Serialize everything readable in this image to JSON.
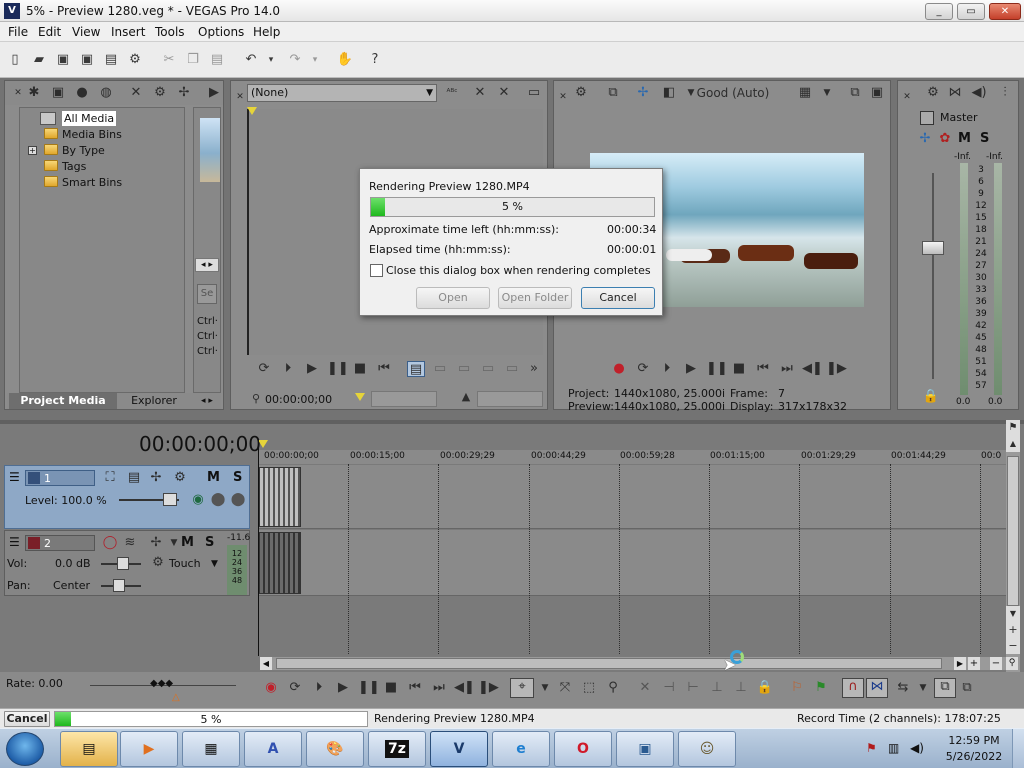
{
  "window": {
    "title": "5% - Preview 1280.veg * - VEGAS Pro 14.0",
    "minimize": "_",
    "maximize": "▭",
    "close": "✕"
  },
  "menu": [
    "File",
    "Edit",
    "View",
    "Insert",
    "Tools",
    "Options",
    "Help"
  ],
  "project_media": {
    "tree": [
      "All Media",
      "Media Bins",
      "By Type",
      "Tags",
      "Smart Bins"
    ],
    "tabs": [
      "Project Media",
      "Explorer"
    ],
    "side_labels": [
      "Ctrl·",
      "Ctrl·",
      "Ctrl·"
    ],
    "arrows": "◂ ▸",
    "se_icon": "Se"
  },
  "trimmer": {
    "dropdown": "(None)",
    "timecode": "00:00:00;00"
  },
  "preview": {
    "quality": "Good (Auto)",
    "project_label": "Project:",
    "project_value": "1440x1080, 25.000i",
    "preview_label": "Preview:",
    "preview_value": "1440x1080, 25.000i",
    "frame_label": "Frame:",
    "frame_value": "7",
    "display_label": "Display:",
    "display_value": "317x178x32"
  },
  "master": {
    "label": "Master",
    "m": "M",
    "s": "S",
    "inf_left": "-Inf.",
    "inf_right": "-Inf.",
    "scale": [
      "3",
      "6",
      "9",
      "12",
      "15",
      "18",
      "21",
      "24",
      "27",
      "30",
      "33",
      "36",
      "39",
      "42",
      "45",
      "48",
      "51",
      "54",
      "57"
    ],
    "bottom_left": "0.0",
    "bottom_right": "0.0"
  },
  "dialog": {
    "title": "Rendering Preview 1280.MP4",
    "progress_label": "5 %",
    "progress": 0.05,
    "time_left_label": "Approximate time left (hh:mm:ss):",
    "time_left_value": "00:00:34",
    "elapsed_label": "Elapsed time (hh:mm:ss):",
    "elapsed_value": "00:00:01",
    "checkbox_label": "Close this dialog box when rendering completes",
    "open_btn": "Open",
    "open_folder_btn": "Open Folder",
    "cancel_btn": "Cancel"
  },
  "timeline": {
    "timecode": "00:00:00;00",
    "ruler": [
      "00:00:00;00",
      "00:00:15;00",
      "00:00:29;29",
      "00:00:44;29",
      "00:00:59;28",
      "00:01:15;00",
      "00:01:29;29",
      "00:01:44;29",
      "00:0"
    ],
    "video_track": {
      "number": "1",
      "m": "M",
      "s": "S",
      "level": "Level: 100.0 %"
    },
    "audio_track": {
      "number": "2",
      "m": "M",
      "s": "S",
      "peak": "-11.6",
      "meter": [
        "12",
        "24",
        "36",
        "48"
      ],
      "vol_label": "Vol:",
      "vol_value": "0.0 dB",
      "pan_label": "Pan:",
      "pan_value": "Center",
      "touch": "Touch"
    },
    "rate": "Rate: 0.00"
  },
  "status": {
    "cancel": "Cancel",
    "progress_label": "5 %",
    "progress": 0.05,
    "message": "Rendering Preview 1280.MP4",
    "record_time": "Record Time (2 channels): 178:07:25"
  },
  "taskbar": {
    "apps": [
      "explorer-icon",
      "media-player-icon",
      "notepad-icon",
      "font-icon",
      "paint-icon",
      "7zip-icon",
      "vegas-icon",
      "ie-icon",
      "opera-icon",
      "network-icon",
      "users-icon"
    ],
    "seven_zip": "7z",
    "time": "12:59 PM",
    "date": "5/26/2022"
  }
}
